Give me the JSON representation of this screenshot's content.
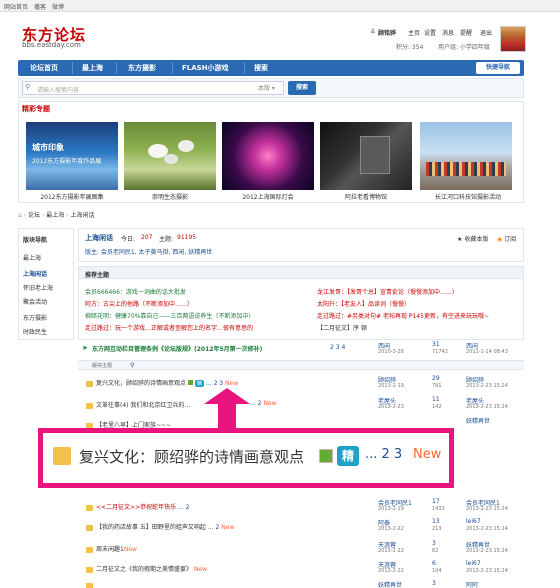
{
  "topbar": {
    "links": [
      "网站首页",
      "播客",
      "微博"
    ]
  },
  "logo": {
    "name": "东方论坛",
    "url": "bbs.eastday.com"
  },
  "user": {
    "name": "顾铭骅",
    "links": [
      "主页",
      "设置",
      "消息",
      "提醒",
      "退出"
    ],
    "points": "积分: 354",
    "group": "用户组: 小学四年级"
  },
  "nav": {
    "items": [
      "论坛首页",
      "最上海",
      "东方摄影",
      "FLASH小游戏",
      "搜索"
    ],
    "quick": "快捷导航"
  },
  "search": {
    "placeholder": "请输入搜索内容",
    "scope": "本版",
    "button": "搜索"
  },
  "photos": {
    "title": "精彩专题",
    "items": [
      {
        "caption": "2012东方摄影年展图集"
      },
      {
        "caption": "崇明生态摄影"
      },
      {
        "caption": "2012上海国际灯会"
      },
      {
        "caption": "阿拉老看博物馆"
      },
      {
        "caption": "长江河口科技馆摄影活动"
      }
    ]
  },
  "breadcrumb": [
    "论坛",
    "最上海",
    "上海闲话"
  ],
  "sidebar": {
    "title": "版块导航",
    "items": [
      "最上海",
      "上海闲话",
      "怀旧老上海",
      "聚会活动",
      "东方摄影",
      "时政民生"
    ]
  },
  "forum": {
    "name": "上海闲话",
    "today_label": "今日:",
    "today": "207",
    "topics_label": "主题:",
    "topics": "91195",
    "mods": "版主: 会员老同民1, 太子黄马褂, 西闲, 妖精再世",
    "fav": "收藏本版",
    "rss": "订阅"
  },
  "pins": {
    "title": "推荐主题",
    "items": [
      "会员666466：游戏一词曲的话大批发",
      "龙江发哥：【发哥个总】宣青俞论（慢慢添加中……）",
      "阿方：古尖上的他路（不断添加中……）",
      "太阳升：【老友人】品读词（慢慢）",
      "柳暗花明：健康70%靠自己——三百两语说养生（不断添加中）",
      "走过路过：#另类对句# 老帖再现 P145更新，有空进来玩玩哦~",
      "走过路过：玩一个游戏…正解或者歪解您上的名字…很有意思的",
      "【二月征文】序 顿"
    ]
  },
  "threads": {
    "notice": {
      "title": "东方网互动栏目管理条例《论坛版规》(2012年5月第一次修补)",
      "pages": "2 3 4",
      "author": "西闲",
      "date": "2010-3-26",
      "replies": "31",
      "views": "71742",
      "last": "西闲",
      "lastdate": "2011-1-14 08:43"
    },
    "section": "版块主题",
    "rows": [
      {
        "title": "复兴文化，顾绍骅的诗情画意观点",
        "pages": "... 2 3",
        "new": "New",
        "author": "顾绍骅",
        "date": "2013-2-19",
        "replies": "29",
        "views": "791",
        "last": "顾绍骅",
        "lastdate": "2013-2-23 15:24"
      },
      {
        "title": "文革往事(4) 我们和北京红卫兵的…",
        "pages": "... 2",
        "new": "New",
        "author": "老屋头",
        "date": "2013-2-23",
        "replies": "11",
        "views": "142",
        "last": "老屋头",
        "lastdate": "2013-2-23 15:24"
      },
      {
        "title": "【老里八早】上门家族~~~",
        "pages": "... 2",
        "new": "",
        "author": "妖精再世",
        "date": "2013-2-21",
        "replies": "12",
        "views": "89",
        "last": "妖精再世",
        "lastdate": "2013-2-23 15:24"
      },
      {
        "title": "<<二月征文>>恭祝蛇年快乐",
        "pages": "... 2",
        "new": "",
        "author": "会员老同民1",
        "date": "2013-2-19",
        "replies": "17",
        "views": "1433",
        "last": "会员老同民1",
        "lastdate": "2013-2-23 15:24"
      },
      {
        "title": "【我的药店故事 五】田野里的蛙声又响起",
        "pages": "... 2",
        "new": "New",
        "author": "阿泰",
        "date": "2013-2-22",
        "replies": "13",
        "views": "213",
        "last": "lei67",
        "lastdate": "2013-2-23 15:24"
      },
      {
        "title": "周末闲趣1",
        "pages": "",
        "new": "New",
        "author": "天涯蓉",
        "date": "2013-2-22",
        "replies": "3",
        "views": "62",
        "last": "妖精再世",
        "lastdate": "2013-2-23 15:24"
      },
      {
        "title": "二月征文之《我的假期之美情盛宴》",
        "pages": "",
        "new": "New",
        "author": "天涯蓉",
        "date": "2013-2-22",
        "replies": "6",
        "views": "104",
        "last": "lei67",
        "lastdate": "2013-2-23 15:24"
      },
      {
        "title": "",
        "pages": "",
        "new": "",
        "author": "妖精再世",
        "date": "",
        "replies": "3",
        "views": "",
        "last": "阿阿",
        "lastdate": ""
      }
    ]
  },
  "zoom": {
    "title": "复兴文化：顾绍骅的诗情画意观点",
    "pages": "... 2 3",
    "new": "New",
    "badge": "精"
  },
  "colors": {
    "brand": "#c80000",
    "nav": "#2a6ab3",
    "highlight": "#e9147f",
    "new": "#ff6633"
  }
}
